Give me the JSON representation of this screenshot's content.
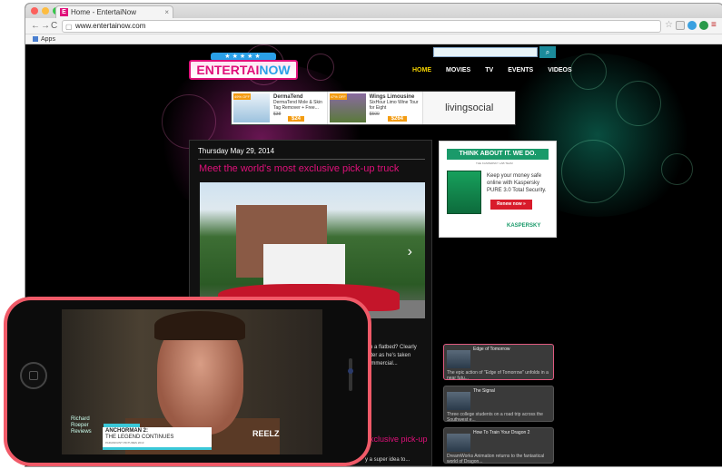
{
  "browser": {
    "tab_title": "Home - EntertaiNow",
    "tab_close": "×",
    "favicon_letter": "E",
    "url": "www.entertainow.com",
    "bookmarks_label": "Apps",
    "back": "←",
    "forward": "→",
    "reload": "C"
  },
  "site": {
    "logo_main": "ENTERTAI",
    "logo_accent": "NOW",
    "logo_stars": "★★★★★",
    "search_button": "⌕",
    "nav": [
      "HOME",
      "MOVIES",
      "TV",
      "EVENTS",
      "VIDEOS"
    ],
    "active_nav": "HOME"
  },
  "ads": [
    {
      "tag": "49% OFF",
      "title": "DermaTend",
      "desc": "DermaTend Mole & Skin Tag Remover + Free...",
      "was": "$38",
      "price": "$24"
    },
    {
      "tag": "47% OFF",
      "title": "Wings Limousine",
      "desc": "SixHour Limo Wine Tour for Eight",
      "was": "$500",
      "price": "$264"
    }
  ],
  "ad_brand": "livingsocial",
  "article": {
    "date": "Thursday May 29, 2014",
    "headline": "Meet the world's most exclusive pick-up truck",
    "snippet_lines": [
      "nto a flatbed? Clearly",
      "latter as he's taken",
      "commercial..."
    ],
    "headline2": "exclusive pick-up",
    "snippet2": "y a super idea to..."
  },
  "kaspersky": {
    "headline": "THINK ABOUT IT. WE DO.",
    "subline": "THE KASPERSKY LAB TEAM",
    "body": "Keep your money safe online with Kaspersky PURE 3.0 Total Security.",
    "button": "Renew now »",
    "brand": "KASPERSKY"
  },
  "videos": [
    {
      "title": "Edge of Tomorrow",
      "desc": "The epic action of \"Edge of Tomorrow\" unfolds in a near futu..."
    },
    {
      "title": "The Signal",
      "desc": "Three college students on a road trip across the Southwest e..."
    },
    {
      "title": "How To Train Your Dragon 2",
      "desc": "DreamWorks Animation returns to the fantastical world of Dragon..."
    }
  ],
  "phone": {
    "lower_third_1": "Richard Roeper Reviews",
    "film_line1": "ANCHORMAN 2:",
    "film_line2": "THE LEGEND CONTINUES",
    "film_line3": "PARAMOUNT PICTURES 2013",
    "network": "REELZ"
  }
}
